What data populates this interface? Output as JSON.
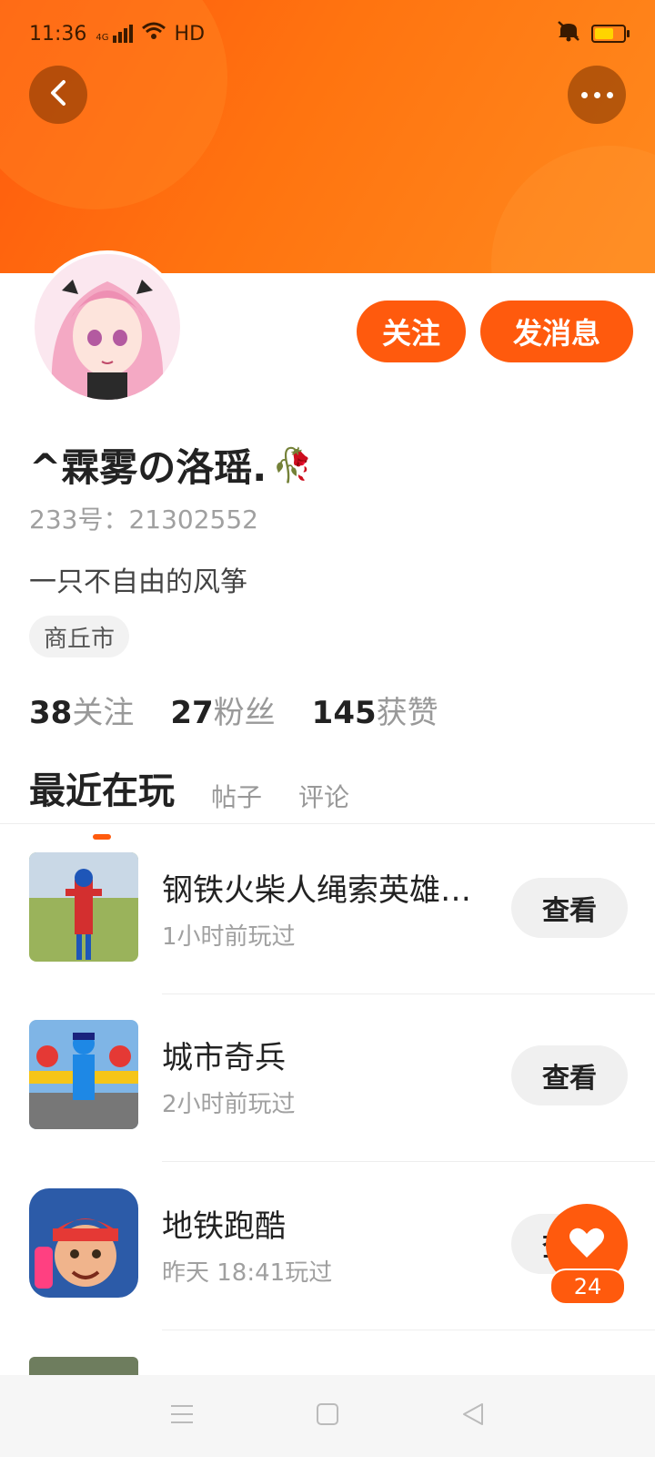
{
  "status_bar": {
    "time": "11:36",
    "network": "4G",
    "hd": "HD"
  },
  "colors": {
    "accent": "#ff5a0d",
    "header_gradient_start": "#ff5a0d",
    "header_gradient_end": "#ff8a1e"
  },
  "profile": {
    "name": "^霖雾の洛瑶.",
    "name_emoji": "🥀",
    "uid": "233号：21302552",
    "bio": "一只不自由的风筝",
    "city": "商丘市"
  },
  "actions": {
    "follow_label": "关注",
    "message_label": "发消息"
  },
  "stats": [
    {
      "num": "38",
      "label": "关注"
    },
    {
      "num": "27",
      "label": "粉丝"
    },
    {
      "num": "145",
      "label": "获赞"
    }
  ],
  "tabs": [
    {
      "label": "最近在玩"
    },
    {
      "label": "帖子"
    },
    {
      "label": "评论"
    }
  ],
  "games": [
    {
      "name": "钢铁火柴人绳索英雄…",
      "time": "1小时前玩过",
      "action": "查看"
    },
    {
      "name": "城市奇兵",
      "time": "2小时前玩过",
      "action": "查看"
    },
    {
      "name": "地铁跑酷",
      "time": "昨天 18:41玩过",
      "action": "查看"
    }
  ],
  "like": {
    "count": "24"
  },
  "icons": {
    "back": "chevron-left-icon",
    "more": "more-dots-icon",
    "like": "heart-icon",
    "nav_menu": "menu-icon",
    "nav_home": "square-icon",
    "nav_back": "triangle-back-icon"
  }
}
